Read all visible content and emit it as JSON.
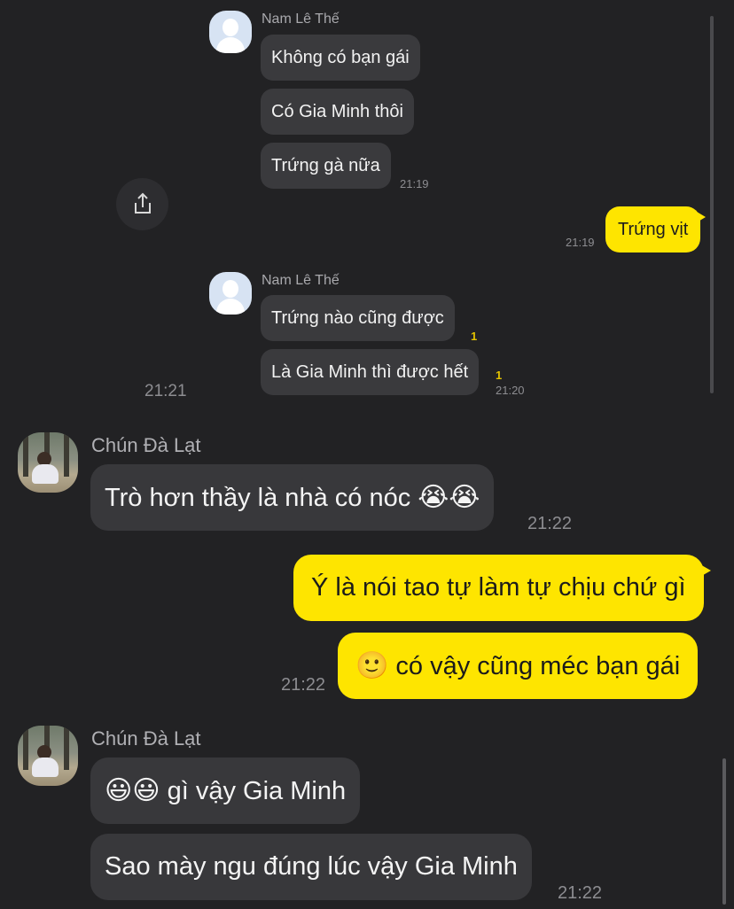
{
  "quoted": {
    "block1": {
      "sender": "Nam Lê Thế",
      "messages": [
        "Không có bạn gái",
        "Có Gia Minh thôi",
        "Trứng gà nữa"
      ],
      "time": "21:19"
    },
    "my_msg": {
      "text": "Trứng vịt",
      "time": "21:19"
    },
    "block2": {
      "sender": "Nam Lê Thế",
      "messages": [
        "Trứng nào cũng được",
        "Là Gia Minh thì được hết"
      ],
      "unread": [
        "1",
        "1"
      ],
      "time": "21:20"
    },
    "outer_time": "21:21",
    "share_icon": "share-icon"
  },
  "chat": {
    "block1": {
      "sender": "Chún Đà Lạt",
      "text": "Trò hơn thầy là nhà có nóc",
      "emoji": "😭😭",
      "time": "21:22"
    },
    "mine": {
      "line1": "Ý là nói tao tự làm tự chịu chứ gì",
      "line2_emoji": "🙂",
      "line2": "có vậy cũng méc bạn gái",
      "time": "21:22"
    },
    "block2": {
      "sender": "Chún Đà Lạt",
      "msg1_emoji": "😃😃",
      "msg1": "gì vậy Gia Minh",
      "msg2": "Sao mày ngu đúng lúc vậy Gia Minh",
      "time": "21:22"
    }
  },
  "colors": {
    "background": "#222224",
    "bubble": "#38383b",
    "my_bubble": "#fee500"
  }
}
